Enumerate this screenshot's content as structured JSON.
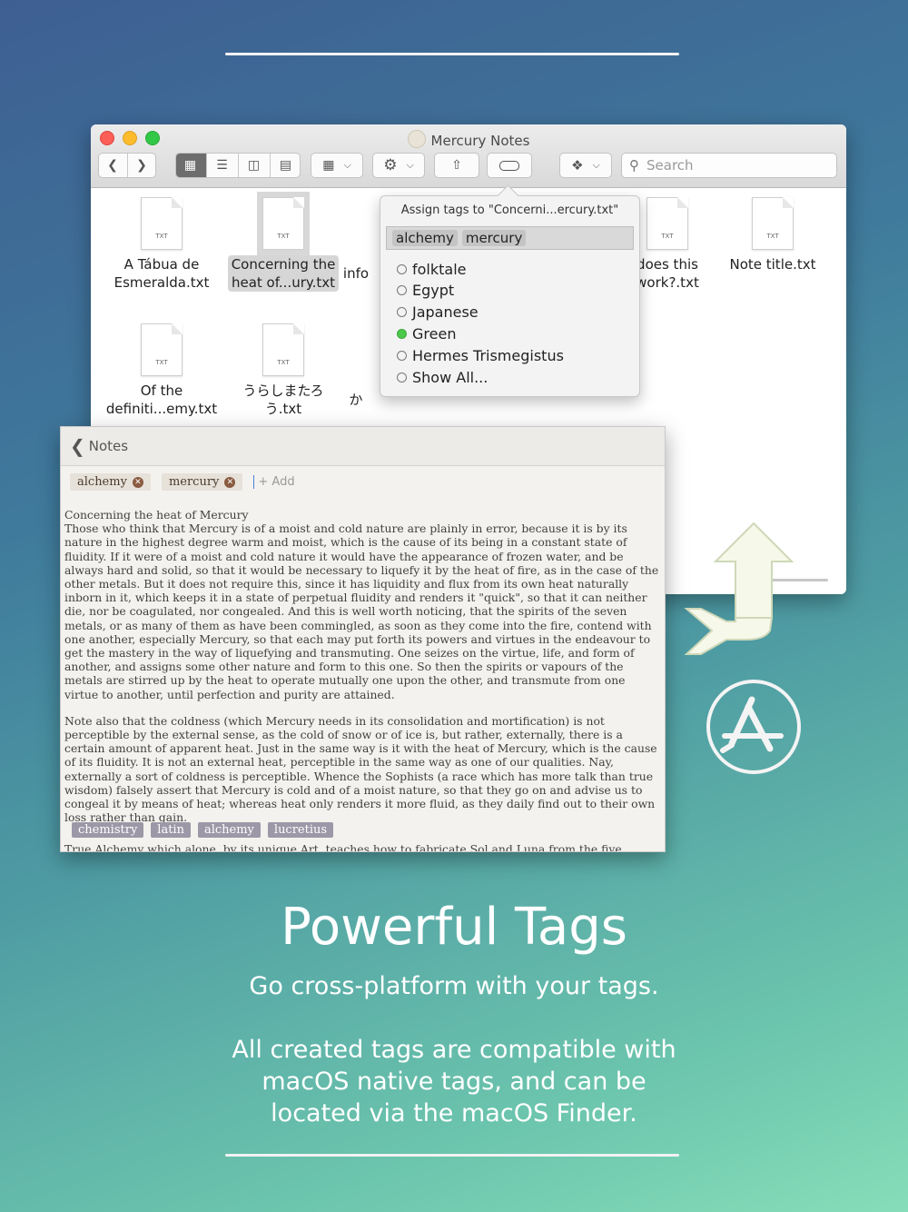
{
  "window": {
    "title": "Mercury Notes",
    "search_placeholder": "Search"
  },
  "files": [
    {
      "name_line1": "A Tábua de",
      "name_line2": "Esmeralda.txt"
    },
    {
      "name_line1": "Concerning the",
      "name_line2": "heat of...ury.txt"
    },
    {
      "name_line1": "info",
      "name_line2": ""
    },
    {
      "name_line1": "does this",
      "name_line2": "work?.txt"
    },
    {
      "name_line1": "Note title.txt",
      "name_line2": ""
    },
    {
      "name_line1": "Of the",
      "name_line2": "definiti...emy.txt"
    },
    {
      "name_line1": "うらしまたろ",
      "name_line2": "う.txt"
    },
    {
      "name_line1": "か",
      "name_line2": ""
    }
  ],
  "popover": {
    "title": "Assign tags to \"Concerni...ercury.txt\"",
    "assigned": [
      "alchemy",
      "mercury"
    ],
    "options": [
      "folktale",
      "Egypt",
      "Japanese",
      "Green",
      "Hermes Trismegistus",
      "Show All..."
    ]
  },
  "notes": {
    "back_label": "Notes",
    "tags": [
      "alchemy",
      "mercury"
    ],
    "add_label": "+ Add",
    "title": "Concerning the heat of Mercury",
    "para1": "Those who think that Mercury is of a moist and cold nature are plainly in error, because it is by its nature in the highest degree warm and moist, which is the cause of its being in a constant state of fluidity. If it were of a moist and cold nature it would have the appearance of frozen water, and be always hard and solid, so that it would be necessary to liquefy it by the heat of fire, as in the case of the other metals. But it does not require this, since it has liquidity and flux from its own heat naturally inborn in it, which keeps it in a state of perpetual fluidity and renders it \"quick\", so that it can neither die, nor be coagulated, nor congealed. And this is well worth noticing, that the spirits of the seven metals, or as many of them as have been commingled, as soon as they come into the fire, contend with one another, especially Mercury, so that each may put forth its powers and virtues in the endeavour to get the mastery in the way of liquefying and transmuting. One seizes on the virtue, life, and form of another, and assigns some other nature and form to this one. So then the spirits or vapours of the metals are stirred up by the heat to operate mutually one upon the other, and transmute from one virtue to another, until perfection and purity are attained.",
    "para2": "Note also that the coldness (which Mercury needs in its consolidation and mortification) is not perceptible by the external sense, as the cold of snow or of ice is, but rather, externally, there is a certain amount of apparent heat. Just in the same way is it with the heat of Mercury, which is the cause of its fluidity. It is not an external heat, perceptible in the same way as one of our qualities. Nay, externally a sort of coldness is perceptible. Whence the Sophists (a race which has more talk than true wisdom) falsely assert that Mercury is cold and of a moist nature, so that they go on and advise us to congeal it by means of heat; whereas heat only renders it more fluid, as they daily find out to their own loss rather than gain.",
    "para3": "True Alchemy which alone, by its unique Art, teaches how to fabricate Sol and Luna from the five imperfect metals, well and truly says: Only from metals, in metals, by metals, and with metals, are perfect metals made, for in some things is Luna and in other metals is Sol.",
    "suggested_tags": [
      "chemistry",
      "latin",
      "alchemy",
      "lucretius"
    ]
  },
  "marketing": {
    "headline": "Powerful Tags",
    "line1": "Go cross-platform with your tags.",
    "line2": "All created tags are compatible with",
    "line3": "macOS native tags, and can be",
    "line4": "located via the macOS Finder."
  },
  "colors": {
    "close": "#fc5f57",
    "minimize": "#fdbc2e",
    "zoom": "#33c748",
    "green_tag": "#4cc84a"
  },
  "icons": [
    "back-icon",
    "forward-icon",
    "icon-view-icon",
    "list-view-icon",
    "column-view-icon",
    "gallery-view-icon",
    "group-icon",
    "gear-icon",
    "share-icon",
    "tag-icon",
    "dropbox-icon",
    "search-icon",
    "sync-arrows-icon",
    "app-store-icon"
  ]
}
